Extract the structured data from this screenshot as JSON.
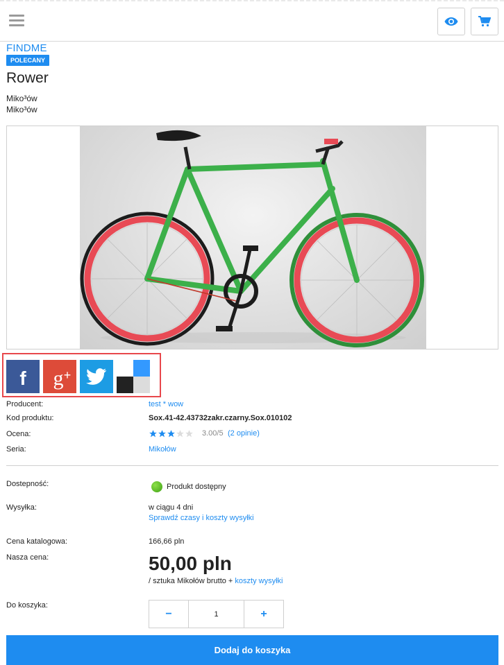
{
  "header": {
    "menu_icon": "hamburger-icon",
    "view_icon": "eye-icon",
    "cart_icon": "cart-icon"
  },
  "product": {
    "brand": "FINDME",
    "badge": "POLECANY",
    "name": "Rower",
    "location_line1": "Miko³ów",
    "location_line2": "Miko³ów"
  },
  "social": [
    "facebook-icon",
    "google-plus-icon",
    "twitter-icon",
    "delicious-icon"
  ],
  "details": {
    "producer_label": "Producent:",
    "producer_value": "test * wow",
    "code_label": "Kod produktu:",
    "code_value": "Sox.41-42.43732zakr.czarny.Sox.010102",
    "rating_label": "Ocena:",
    "rating_value": 3,
    "rating_max": 5,
    "rating_text": "3.00/5",
    "rating_link": "(2 opinie)",
    "series_label": "Seria:",
    "series_value": "Mikołów"
  },
  "availability": {
    "label": "Dostepność:",
    "value": "Produkt dostępny",
    "status_color": "#5cc22a"
  },
  "shipping": {
    "label": "Wysyłka:",
    "value": "w ciągu 4 dni",
    "link": "Sprawdź czasy i koszty wysyłki"
  },
  "catalog_price": {
    "label": "Cena katalogowa:",
    "value": "166,66 pln"
  },
  "our_price": {
    "label": "Nasza cena:",
    "value": "50,00 pln",
    "unit_text": "/ sztuka Mikołów brutto + ",
    "shipping_link": "koszty wysyłki"
  },
  "cart": {
    "label": "Do koszyka:",
    "minus": "−",
    "plus": "+",
    "quantity": "1",
    "add_button": "Dodaj do koszyka"
  },
  "colors": {
    "accent": "#1e8cf0",
    "highlight_border": "#e8474b"
  }
}
